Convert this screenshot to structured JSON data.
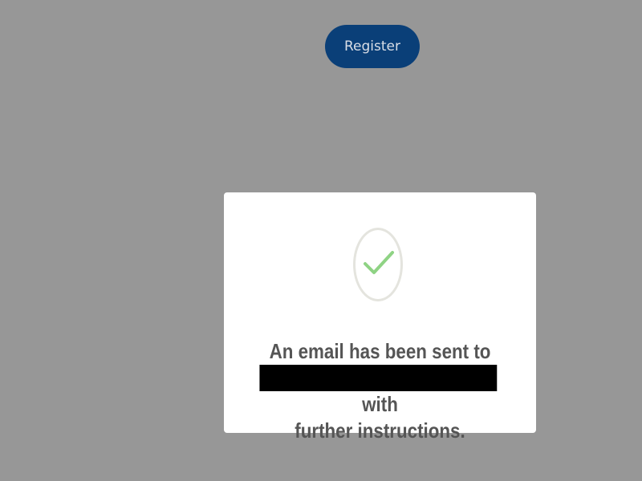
{
  "header": {
    "register_label": "Register"
  },
  "modal": {
    "icon": "checkmark-icon",
    "message_line1": "An email has been sent to",
    "message_line2_suffix": "with",
    "message_line3": "further instructions."
  },
  "colors": {
    "background": "#979797",
    "register_button": "#0a3f78",
    "checkmark": "#8fd384",
    "text": "#555555"
  }
}
